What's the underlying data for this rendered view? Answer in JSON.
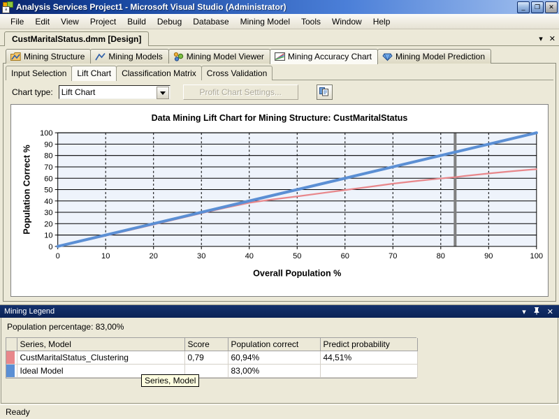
{
  "window": {
    "title": "Analysis Services Project1 - Microsoft Visual Studio (Administrator)",
    "minimize": "_",
    "restore": "❐",
    "close": "✕"
  },
  "menu": [
    "File",
    "Edit",
    "View",
    "Project",
    "Build",
    "Debug",
    "Database",
    "Mining Model",
    "Tools",
    "Window",
    "Help"
  ],
  "document_tab": {
    "label": "CustMaritalStatus.dmm [Design]",
    "dropdown": "▾",
    "close": "✕"
  },
  "main_tabs": [
    {
      "label": "Mining Structure",
      "icon": "mining-structure-icon",
      "active": false
    },
    {
      "label": "Mining Models",
      "icon": "mining-models-icon",
      "active": false
    },
    {
      "label": "Mining Model Viewer",
      "icon": "mining-model-viewer-icon",
      "active": false
    },
    {
      "label": "Mining Accuracy Chart",
      "icon": "mining-accuracy-chart-icon",
      "active": true
    },
    {
      "label": "Mining Model Prediction",
      "icon": "mining-model-prediction-icon",
      "active": false
    }
  ],
  "sub_tabs": [
    {
      "label": "Input Selection",
      "active": false
    },
    {
      "label": "Lift Chart",
      "active": true
    },
    {
      "label": "Classification Matrix",
      "active": false
    },
    {
      "label": "Cross Validation",
      "active": false
    }
  ],
  "toolbar": {
    "chart_type_label": "Chart type:",
    "chart_type_value": "Lift Chart",
    "profit_chart_settings_label": "Profit Chart Settings...",
    "copy_icon": "copy-to-clipboard-icon"
  },
  "legend": {
    "panel_title": "Mining Legend",
    "dropdown_icon": "▾",
    "pin_icon": "pin-icon",
    "close_icon": "✕",
    "population_percentage": "Population percentage: 83,00%",
    "columns": [
      "",
      "Series, Model",
      "Score",
      "Population correct",
      "Predict probability"
    ],
    "rows": [
      {
        "color": "#e8878b",
        "series": "CustMaritalStatus_Clustering",
        "score": "0,79",
        "population_correct": "60,94%",
        "predict_probability": "44,51%"
      },
      {
        "color": "#5b8fd4",
        "series": "Ideal Model",
        "score": "",
        "population_correct": "83,00%",
        "predict_probability": ""
      }
    ],
    "tooltip": "Series, Model"
  },
  "status_bar": {
    "text": "Ready"
  },
  "chart_data": {
    "type": "line",
    "title": "Data Mining Lift Chart for Mining Structure: CustMaritalStatus",
    "xlabel": "Overall Population %",
    "ylabel": "Population Correct %",
    "xlim": [
      0,
      100
    ],
    "ylim": [
      0,
      100
    ],
    "xticks": [
      0,
      10,
      20,
      30,
      40,
      50,
      60,
      70,
      80,
      90,
      100
    ],
    "yticks": [
      0,
      10,
      20,
      30,
      40,
      50,
      60,
      70,
      80,
      90,
      100
    ],
    "grid": true,
    "plot_background": "#eef3fb",
    "marker_line": {
      "x": 83,
      "color": "#808080",
      "label": "83,00%"
    },
    "series": [
      {
        "name": "Ideal Model",
        "color": "#5b8fd4",
        "x": [
          0,
          10,
          20,
          30,
          40,
          50,
          60,
          70,
          80,
          83,
          90,
          100
        ],
        "values": [
          0,
          10,
          20,
          30,
          40,
          50,
          60,
          70,
          80,
          83,
          90,
          100
        ]
      },
      {
        "name": "CustMaritalStatus_Clustering",
        "color": "#e8878b",
        "x": [
          0,
          5,
          10,
          20,
          25,
          30,
          35,
          40,
          45,
          50,
          55,
          60,
          65,
          70,
          75,
          80,
          83,
          85,
          90,
          95,
          100
        ],
        "values": [
          0,
          4.6,
          9.4,
          19.2,
          24.2,
          29.2,
          34.0,
          38.4,
          41.4,
          44.0,
          46.8,
          49.6,
          52.4,
          55.2,
          57.6,
          59.8,
          60.94,
          62.0,
          64.2,
          66.2,
          68.0
        ]
      }
    ]
  }
}
